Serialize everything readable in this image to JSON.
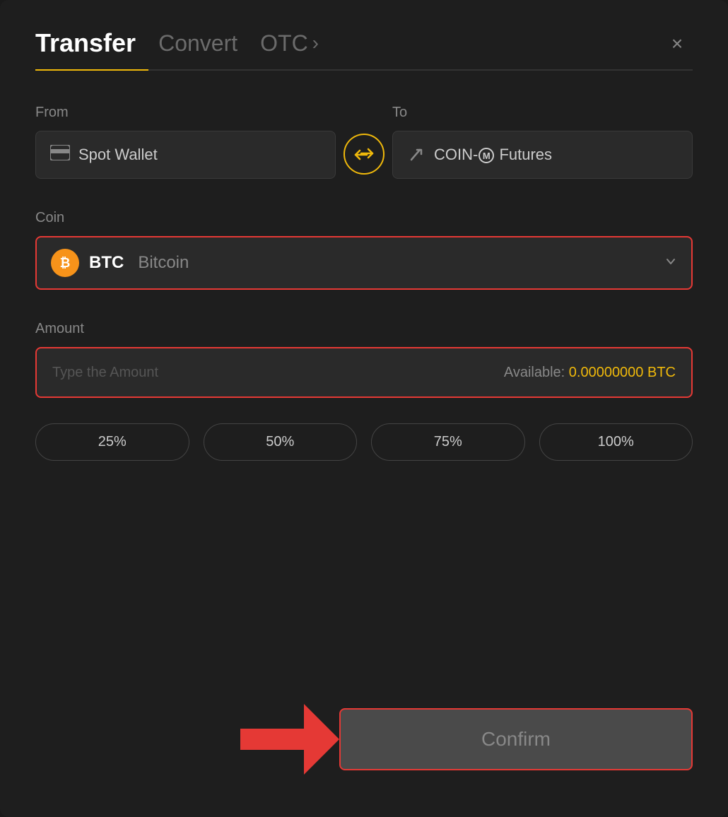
{
  "header": {
    "tab_transfer": "Transfer",
    "tab_convert": "Convert",
    "tab_otc": "OTC",
    "tab_otc_arrow": "›",
    "close_icon": "×"
  },
  "from_section": {
    "label": "From",
    "wallet_name": "Spot Wallet"
  },
  "to_section": {
    "label": "To",
    "wallet_name": "COIN-M Futures"
  },
  "coin_section": {
    "label": "Coin",
    "coin_symbol": "BTC",
    "coin_name": "Bitcoin",
    "coin_icon": "₿"
  },
  "amount_section": {
    "label": "Amount",
    "placeholder": "Type the Amount",
    "available_label": "Available:",
    "available_amount": "0.00000000 BTC"
  },
  "percent_buttons": [
    "25%",
    "50%",
    "75%",
    "100%"
  ],
  "confirm_button": {
    "label": "Confirm"
  },
  "colors": {
    "accent": "#f0b90b",
    "error_border": "#e53935",
    "bg_dark": "#1e1e1e",
    "bg_input": "#2a2a2a"
  }
}
